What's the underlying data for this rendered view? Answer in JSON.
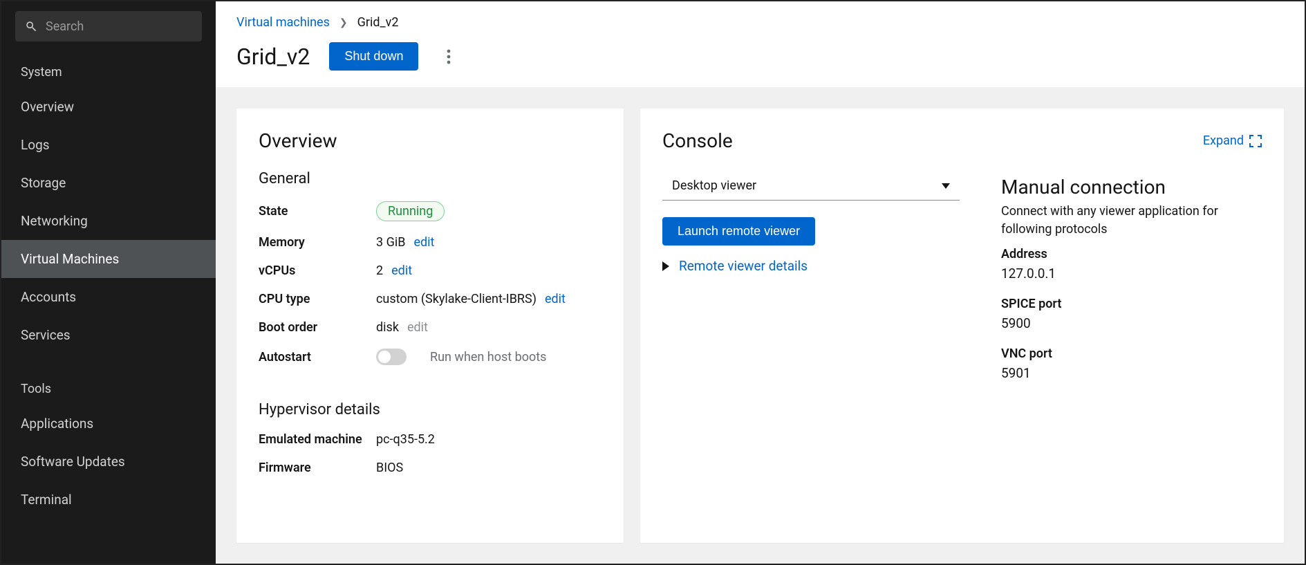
{
  "sidebar": {
    "search_placeholder": "Search",
    "section_system": "System",
    "section_tools": "Tools",
    "items_system": [
      {
        "label": "Overview"
      },
      {
        "label": "Logs"
      },
      {
        "label": "Storage"
      },
      {
        "label": "Networking"
      },
      {
        "label": "Virtual Machines"
      },
      {
        "label": "Accounts"
      },
      {
        "label": "Services"
      }
    ],
    "items_tools": [
      {
        "label": "Applications"
      },
      {
        "label": "Software Updates"
      },
      {
        "label": "Terminal"
      }
    ]
  },
  "breadcrumb": {
    "parent": "Virtual machines",
    "current": "Grid_v2"
  },
  "header": {
    "title": "Grid_v2",
    "shutdown_label": "Shut down"
  },
  "overview": {
    "card_title": "Overview",
    "section_general": "General",
    "section_hypervisor": "Hypervisor details",
    "labels": {
      "state": "State",
      "memory": "Memory",
      "vcpus": "vCPUs",
      "cpu_type": "CPU type",
      "boot_order": "Boot order",
      "autostart": "Autostart",
      "emulated_machine": "Emulated machine",
      "firmware": "Firmware"
    },
    "values": {
      "state": "Running",
      "memory": "3 GiB",
      "vcpus": "2",
      "cpu_type": "custom (Skylake-Client-IBRS)",
      "boot_order": "disk",
      "autostart_hint": "Run when host boots",
      "emulated_machine": "pc-q35-5.2",
      "firmware": "BIOS"
    },
    "edit_label": "edit"
  },
  "console": {
    "card_title": "Console",
    "expand_label": "Expand",
    "viewer_selected": "Desktop viewer",
    "launch_label": "Launch remote viewer",
    "details_label": "Remote viewer details",
    "manual_title": "Manual connection",
    "manual_sub": "Connect with any viewer application for following protocols",
    "address_label": "Address",
    "address_value": "127.0.0.1",
    "spice_label": "SPICE port",
    "spice_value": "5900",
    "vnc_label": "VNC port",
    "vnc_value": "5901"
  }
}
